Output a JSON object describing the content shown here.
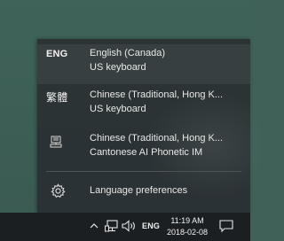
{
  "languages": [
    {
      "icon_text": "ENG",
      "name": "English (Canada)",
      "keyboard": "US keyboard",
      "selected": true
    },
    {
      "icon_text": "繁體",
      "name": "Chinese (Traditional, Hong K...",
      "keyboard": "US keyboard",
      "selected": false
    },
    {
      "icon_text": "",
      "icon": "ime-keyboard-icon",
      "name": "Chinese (Traditional, Hong K...",
      "keyboard": "Cantonese AI Phonetic IM",
      "selected": false
    }
  ],
  "preferences": {
    "icon": "gear-icon",
    "label": "Language preferences"
  },
  "taskbar": {
    "tray_icons": [
      "chevron-up-icon",
      "network-icon",
      "volume-icon"
    ],
    "input_indicator": "ENG",
    "time": "11:19 AM",
    "date": "2018-02-08",
    "notification_icon": "action-center-icon"
  }
}
